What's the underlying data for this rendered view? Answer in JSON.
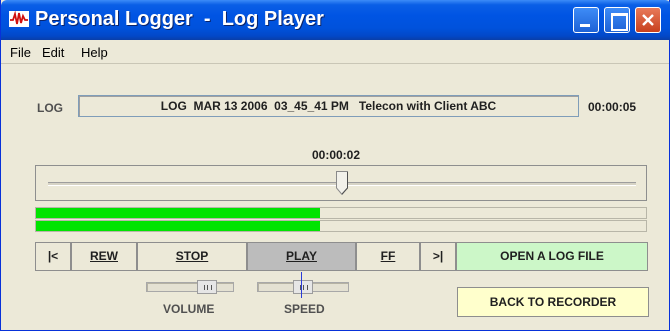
{
  "window": {
    "title": "Personal Logger  -  Log Player",
    "controls": {
      "minimize": "minimize-icon",
      "maximize": "maximize-icon",
      "close": "close-icon"
    }
  },
  "menu": {
    "file": "File",
    "edit": "Edit",
    "help": "Help"
  },
  "log": {
    "label": "LOG",
    "name": "LOG  MAR 13 2006  03_45_41 PM   Telecon with Client ABC",
    "total_time": "00:00:05"
  },
  "position": {
    "time": "00:00:02",
    "fraction": 0.5
  },
  "meters": {
    "left_level": 0.465,
    "right_level": 0.465,
    "color": "#00e400"
  },
  "controls": {
    "first": "|<",
    "rewind": "REW",
    "stop": "STOP",
    "play": "PLAY",
    "fast_forward": "FF",
    "last": ">|",
    "open": "OPEN A LOG FILE",
    "back": "BACK TO RECORDER"
  },
  "volume": {
    "label": "VOLUME",
    "level": 0.75
  },
  "speed": {
    "label": "SPEED",
    "level": 0.5
  },
  "colors": {
    "open_button": "#ccf7c8",
    "back_button": "#ffffcc",
    "play_active": "#bcbcbc"
  }
}
